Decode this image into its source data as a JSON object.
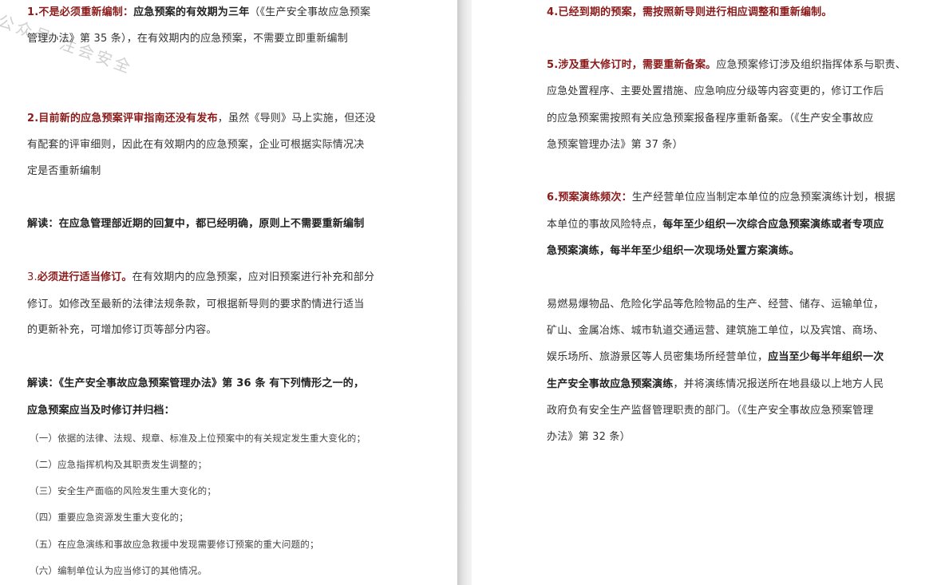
{
  "watermark": "公众号·注会安全",
  "left": {
    "p1_num": "1.",
    "p1_head": "不是必须重新编制：",
    "p1_bold": "应急预案的有效期为三年",
    "p1_rest1": "（《生产安全事故应急预案",
    "p1_line2": "管理办法》第 35 条），在有效期内的应急预案，不需要立即重新编制",
    "p2_head": "2.目前新的应急预案评审指南还没有发布",
    "p2_rest1": "，虽然《导则》马上实施，但还没",
    "p2_line2": "有配套的评审细则，因此在有效期内的应急预案，企业可根据实际情况决",
    "p2_line3": "定是否重新编制",
    "note1": "解读：在应急管理部近期的回复中，都已经明确，原则上不需要重新编制",
    "p3_num": "3.",
    "p3_head": "必须进行适当修订。",
    "p3_rest1": "在有效期内的应急预案，应对旧预案进行补充和部分",
    "p3_line2": "修订。如修改至最新的法律法规条款，可根据新导则的要求酌情进行适当",
    "p3_line3": "的更新补充，可增加修订页等部分内容。",
    "note2_line1": "解读：《生产安全事故应急预案管理办法》第 36 条  有下列情形之一的，",
    "note2_line2": "应急预案应当及时修订并归档：",
    "items": [
      "（一）依据的法律、法规、规章、标准及上位预案中的有关规定发生重大变化的；",
      "（二）应急指挥机构及其职责发生调整的；",
      "（三）安全生产面临的风险发生重大变化的；",
      "（四）重要应急资源发生重大变化的；",
      "（五）在应急演练和事故应急救援中发现需要修订预案的重大问题的；",
      "（六）编制单位认为应当修订的其他情况。"
    ]
  },
  "right": {
    "p4": "4.已经到期的预案，需按照新导则进行相应调整和重新编制。",
    "p5_head": "5.涉及重大修订时，需要重新备案。",
    "p5_rest1": "应急预案修订涉及组织指挥体系与职责、",
    "p5_line2": "应急处置程序、主要处置措施、应急响应分级等内容变更的，修订工作后",
    "p5_line3": "的应急预案需按照有关应急预案报备程序重新备案。（《生产安全事故应",
    "p5_line4": "急预案管理办法》第 37 条）",
    "p6_head": "6.预案演练频次：",
    "p6_rest1": "生产经营单位应当制定本单位的应急预案演练计划，根据",
    "p6_line2a": "本单位的事故风险特点，",
    "p6_line2b": "每年至少组织一次综合应急预案演练或者专项应",
    "p6_line3": "急预案演练，每半年至少组织一次现场处置方案演练。",
    "p7_line1": "易燃易爆物品、危险化学品等危险物品的生产、经营、储存、运输单位，",
    "p7_line2": "矿山、金属冶炼、城市轨道交通运营、建筑施工单位，以及宾馆、商场、",
    "p7_line3a": "娱乐场所、旅游景区等人员密集场所经营单位，",
    "p7_line3b": "应当至少每半年组织一次",
    "p7_line4a": "生产安全事故应急预案演练",
    "p7_line4b": "，并将演练情况报送所在地县级以上地方人民",
    "p7_line5": "政府负有安全生产监督管理职责的部门。（《生产安全事故应急预案管理",
    "p7_line6": "办法》第 32 条）"
  }
}
